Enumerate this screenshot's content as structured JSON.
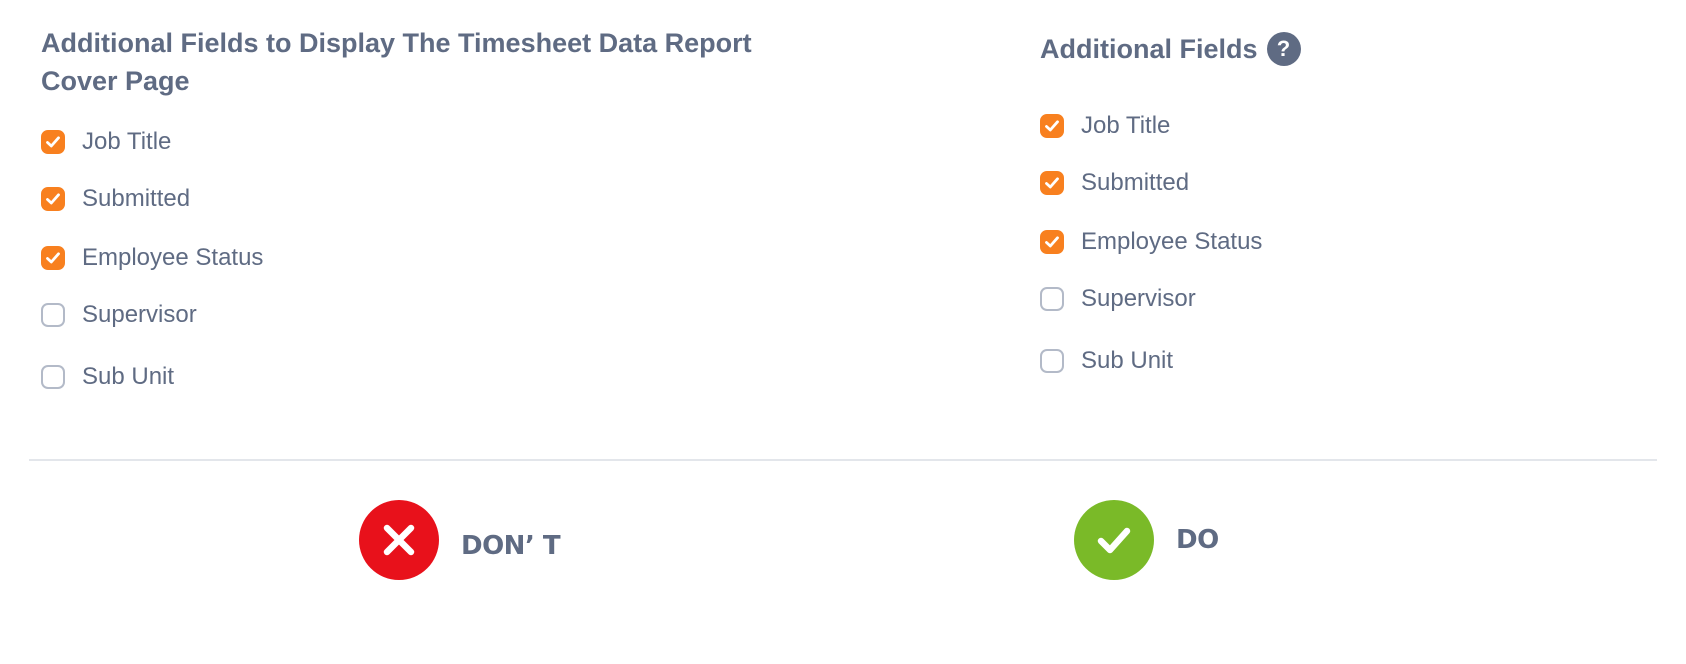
{
  "left_panel": {
    "title": "Additional Fields to Display The Timesheet Data Report Cover Page",
    "fields": [
      {
        "label": "Job Title",
        "checked": true
      },
      {
        "label": "Submitted",
        "checked": true
      },
      {
        "label": "Employee Status",
        "checked": true
      },
      {
        "label": "Supervisor",
        "checked": false
      },
      {
        "label": "Sub Unit",
        "checked": false
      }
    ]
  },
  "right_panel": {
    "title": "Additional Fields",
    "help_icon": "question-mark",
    "help_glyph": "?",
    "fields": [
      {
        "label": "Job Title",
        "checked": true
      },
      {
        "label": "Submitted",
        "checked": true
      },
      {
        "label": "Employee Status",
        "checked": true
      },
      {
        "label": "Supervisor",
        "checked": false
      },
      {
        "label": "Sub Unit",
        "checked": false
      }
    ]
  },
  "verdicts": {
    "dont": {
      "label": "DON’ T",
      "icon": "x-mark",
      "color": "#e8111b"
    },
    "do": {
      "label": "DO",
      "icon": "check-mark",
      "color": "#7aba28"
    }
  },
  "colors": {
    "accent_checked": "#f8801f",
    "text": "#5f6b83",
    "unchecked_border": "#b3bac8"
  }
}
